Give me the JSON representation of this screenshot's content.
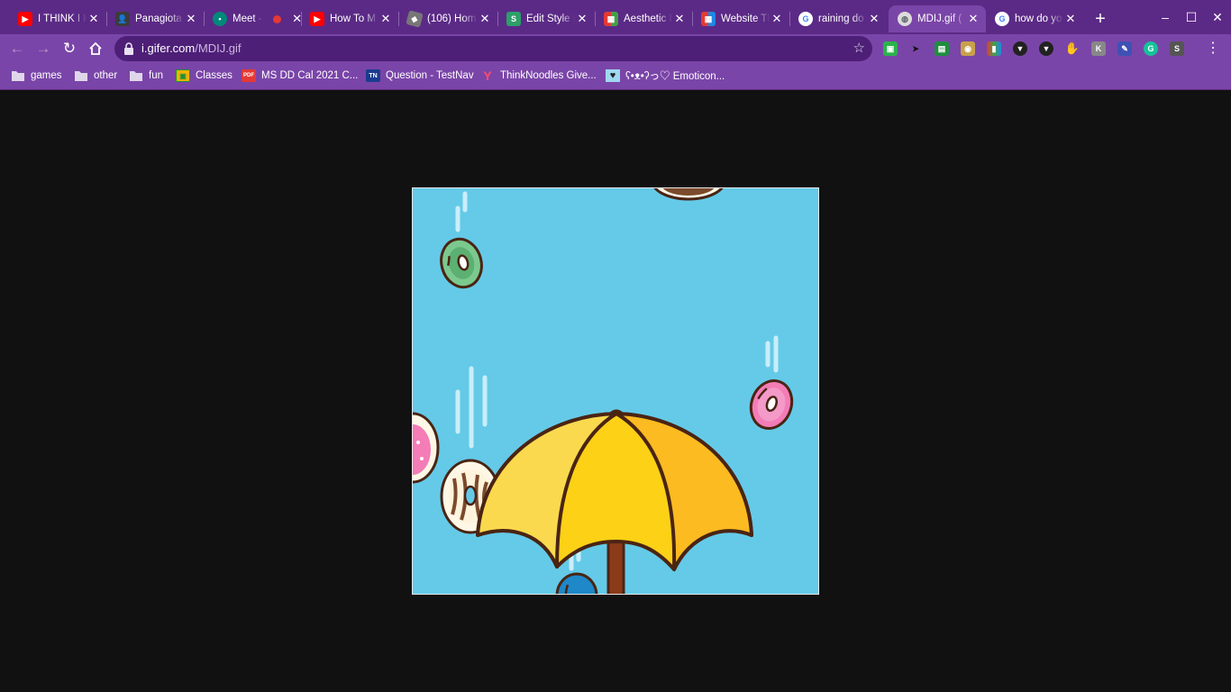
{
  "tabs": [
    {
      "title": "I THINK I K",
      "icon": "youtube-icon",
      "color": "#ff0000"
    },
    {
      "title": "Panagiota",
      "icon": "contact-icon",
      "color": "#3c3c3c"
    },
    {
      "title": "Meet -",
      "icon": "google-meet-icon",
      "color": "#00897b",
      "recording": true
    },
    {
      "title": "How To M",
      "icon": "youtube-icon",
      "color": "#ff0000"
    },
    {
      "title": "(106) Hom",
      "icon": "roblox-icon",
      "color": "#777777"
    },
    {
      "title": "Edit Style I",
      "icon": "stylish-icon",
      "color": "#2e9e6a"
    },
    {
      "title": "Aesthetic I",
      "icon": "grid-app-icon",
      "color": "#e57373"
    },
    {
      "title": "Website Th",
      "icon": "grid-app-icon",
      "color": "#e57373"
    },
    {
      "title": "raining do",
      "icon": "google-icon",
      "color": "#4285f4"
    },
    {
      "title": "MDIJ.gif (",
      "icon": "globe-icon",
      "color": "#5f6368",
      "active": true
    },
    {
      "title": "how do yo",
      "icon": "google-icon",
      "color": "#4285f4"
    }
  ],
  "new_tab_label": "+",
  "window_controls": {
    "minimize": "–",
    "maximize": "☐",
    "close": "✕"
  },
  "address": {
    "host": "i.gifer.com",
    "path": "/MDIJ.gif"
  },
  "extensions": [
    {
      "name": "screencastify-icon",
      "color": "#2bb24c",
      "glyph": "▣"
    },
    {
      "name": "cursor-icon",
      "color": "#222222",
      "glyph": "➤"
    },
    {
      "name": "google-classroom-icon",
      "color": "#1e8e3e",
      "glyph": "▤"
    },
    {
      "name": "camera-icon",
      "color": "#c8a24a",
      "glyph": "◉"
    },
    {
      "name": "colorful-bars-icon",
      "color": "#333333",
      "glyph": "▮"
    },
    {
      "name": "shield-icon",
      "color": "#222222",
      "glyph": "▼"
    },
    {
      "name": "shield-check-icon",
      "color": "#222222",
      "glyph": "▼"
    },
    {
      "name": "hand-icon",
      "color": "#f2a900",
      "glyph": "✋"
    },
    {
      "name": "kami-icon",
      "color": "#888888",
      "glyph": "K"
    },
    {
      "name": "paint-icon",
      "color": "#3f51b5",
      "glyph": "✎"
    },
    {
      "name": "grammarly-icon",
      "color": "#15c39a",
      "glyph": "G"
    },
    {
      "name": "stylus-icon",
      "color": "#555555",
      "glyph": "S"
    }
  ],
  "bookmarks": [
    {
      "label": "games",
      "icon": "folder-icon"
    },
    {
      "label": "other",
      "icon": "folder-icon"
    },
    {
      "label": "fun",
      "icon": "folder-icon"
    },
    {
      "label": "Classes",
      "icon": "google-classroom-icon"
    },
    {
      "label": "MS DD Cal 2021 C...",
      "icon": "pdf-icon"
    },
    {
      "label": "Question - TestNav",
      "icon": "testnav-icon"
    },
    {
      "label": "ThinkNoodles Give...",
      "icon": "y-combinator-icon"
    },
    {
      "label": "ʕ•ᴥ•ʔっ♡ Emoticon...",
      "icon": "heart-icon"
    }
  ],
  "colors": {
    "frame": "#5b2a86",
    "toolbar": "#7a45a8",
    "omnibox": "#4d1f77",
    "page_background": "#111111",
    "gif_sky": "#64cae8",
    "umbrella_yellow": "#fcd116",
    "umbrella_dark_yellow": "#fbbb21",
    "umbrella_light_yellow": "#fad94e",
    "outline": "#4a2413"
  }
}
